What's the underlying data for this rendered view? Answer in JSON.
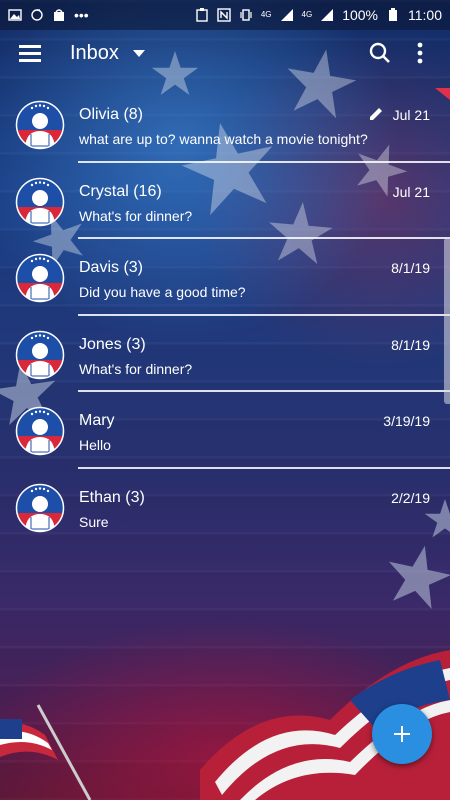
{
  "status_bar": {
    "battery": "100%",
    "time": "11:00",
    "network_left": "4G",
    "network_right": "4G"
  },
  "toolbar": {
    "title": "Inbox"
  },
  "conversations": [
    {
      "name": "Olivia (8)",
      "snippet": "what are up to? wanna watch a movie tonight?",
      "date": "Jul 21",
      "draft": true
    },
    {
      "name": "Crystal (16)",
      "snippet": "What's for dinner?",
      "date": "Jul 21",
      "draft": false
    },
    {
      "name": "Davis (3)",
      "snippet": "Did you have a good time?",
      "date": "8/1/19",
      "draft": false
    },
    {
      "name": "Jones (3)",
      "snippet": "What's for dinner?",
      "date": "8/1/19",
      "draft": false
    },
    {
      "name": "Mary",
      "snippet": "Hello",
      "date": "3/19/19",
      "draft": false
    },
    {
      "name": "Ethan (3)",
      "snippet": "Sure",
      "date": "2/2/19",
      "draft": false
    }
  ],
  "fab": {
    "icon": "plus-icon"
  },
  "colors": {
    "accent": "#2a8fe0",
    "avatar_red": "#d8283a",
    "avatar_blue": "#1e4fa8"
  }
}
